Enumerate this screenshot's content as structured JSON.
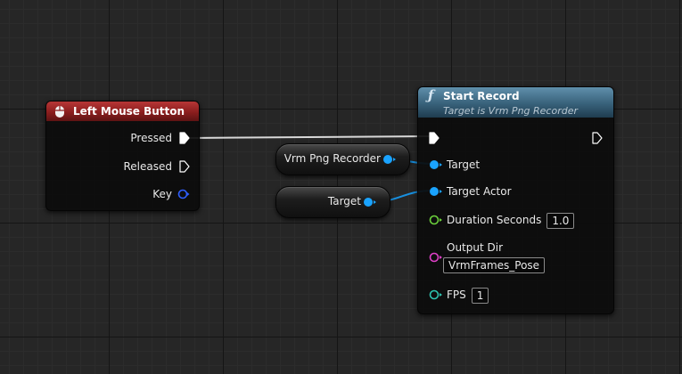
{
  "event_node": {
    "title": "Left Mouse Button",
    "icon": "mouse-icon",
    "header_color": "#8b1e1e",
    "pins": [
      {
        "label": "Pressed",
        "type": "exec",
        "connected": true
      },
      {
        "label": "Released",
        "type": "exec",
        "connected": false
      },
      {
        "label": "Key",
        "type": "struct",
        "color": "#2f5fff",
        "connected": false
      }
    ]
  },
  "function_node": {
    "title": "Start Record",
    "subtitle": "Target is Vrm Png Recorder",
    "icon": "function-icon",
    "header_color": "#38617a",
    "inputs": [
      {
        "label": "Target",
        "type": "object",
        "color": "#1aa3ff"
      },
      {
        "label": "Target Actor",
        "type": "object",
        "color": "#1aa3ff"
      },
      {
        "label": "Duration Seconds",
        "type": "float",
        "color": "#6cd13c",
        "value": "1.0"
      },
      {
        "label": "Output Dir",
        "type": "string",
        "color": "#e040c8",
        "value": "VrmFrames_Pose"
      },
      {
        "label": "FPS",
        "type": "int",
        "color": "#2ec4b0",
        "value": "1"
      }
    ]
  },
  "variable_nodes": [
    {
      "label": "Vrm Png Recorder",
      "color": "#1aa3ff"
    },
    {
      "label": "Target",
      "color": "#1aa3ff"
    }
  ],
  "colors": {
    "exec_wire": "#d8d8d8",
    "object_pin": "#1aa3ff",
    "object_wire": "#1890e0"
  }
}
